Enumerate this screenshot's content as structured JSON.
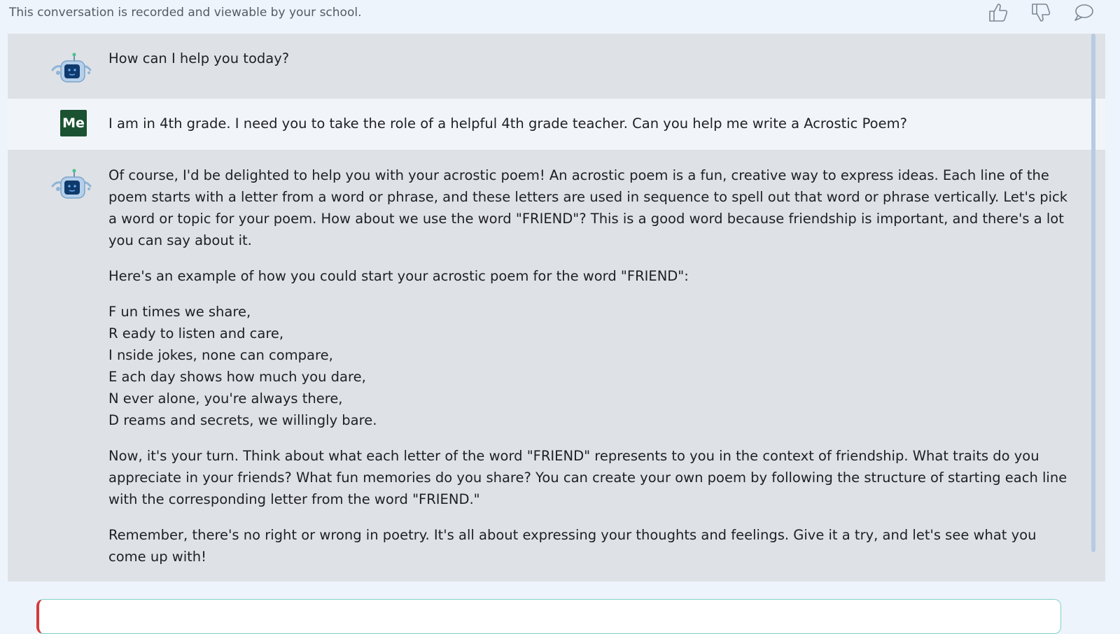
{
  "header": {
    "notice": "This conversation is recorded and viewable by your school.",
    "feedback": [
      {
        "icon": "thumbs-up-icon",
        "label": "Like"
      },
      {
        "icon": "thumbs-down-icon",
        "label": "Dislike"
      },
      {
        "icon": "comment-icon",
        "label": "Comment"
      }
    ]
  },
  "conversation": {
    "messages": [
      {
        "role": "bot",
        "avatar": "robot-icon",
        "text": "How can I help you today?"
      },
      {
        "role": "user",
        "avatar_label": "Me",
        "text": "I am in 4th grade. I need you to take the role of a helpful 4th grade teacher. Can you help me write a Acrostic Poem?"
      },
      {
        "role": "bot",
        "avatar": "robot-icon",
        "paragraphs": [
          "Of course, I'd be delighted to help you with your acrostic poem! An acrostic poem is a fun, creative way to express ideas. Each line of the poem starts with a letter from a word or phrase, and these letters are used in sequence to spell out that word or phrase vertically. Let's pick a word or topic for your poem. How about we use the word \"FRIEND\"? This is a good word because friendship is important, and there's a lot you can say about it.",
          "Here's an example of how you could start your acrostic poem for the word \"FRIEND\":"
        ],
        "poem_lines": [
          "F un times we share,",
          "R eady to listen and care,",
          "I nside jokes, none can compare,",
          "E ach day shows how much you dare,",
          "N ever alone, you're always there,",
          "D reams and secrets, we willingly bare."
        ],
        "closing": [
          "Now, it's your turn. Think about what each letter of the word \"FRIEND\" represents to you in the context of friendship. What traits do you appreciate in your friends? What fun memories do you share? You can create your own poem by following the structure of starting each line with the corresponding letter from the word \"FRIEND.\"",
          "Remember, there's no right or wrong in poetry. It's all about expressing your thoughts and feelings. Give it a try, and let's see what you come up with!"
        ]
      }
    ]
  },
  "colors": {
    "bot_bg": "#dee2e6",
    "user_bg": "#f1f5fa",
    "me_avatar": "#1b5231",
    "page_bg": "#eef4fb"
  }
}
